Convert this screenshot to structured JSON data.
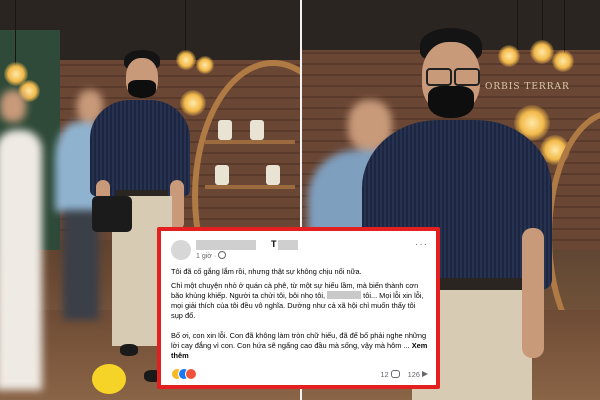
{
  "post": {
    "author_suffix": "T",
    "time": "1 giờ ·",
    "paragraphs": {
      "p1": "Tôi đã cố gắng lắm rồi, nhưng thật sự không chịu nổi nữa.",
      "p2_a": "Chỉ một chuyện nhỏ ở quán cà phê, từ một sự hiểu lầm, mà biến thành cơn bão khủng khiếp. Người ta chửi tôi, bôi nhọ tôi,",
      "p2_b": "tôi... Mọi lỗi xin lỗi, mọi giải thích của tôi đều vô nghĩa. Dường như cả xã hội chỉ muốn thấy tôi sụp đổ.",
      "p3": "Bố ơi, con xin lỗi. Con đã không làm tròn chữ hiếu, đã để bố phải nghe những lời cay đắng vì con. Con hứa sẽ ngẩng cao đầu mà sống, vậy mà hôm ...",
      "see_more": "Xem thêm"
    },
    "comment_count": "12",
    "share_count": "126",
    "reaction_icons": [
      "haha-reaction-icon",
      "like-reaction-icon",
      "sad-reaction-icon"
    ]
  },
  "scene": {
    "sign_text": "ORBIS TERRAR"
  },
  "colors": {
    "frame": "#e41f1f",
    "shirt": "#1f2a44",
    "facebook_blue": "#1877f2"
  }
}
